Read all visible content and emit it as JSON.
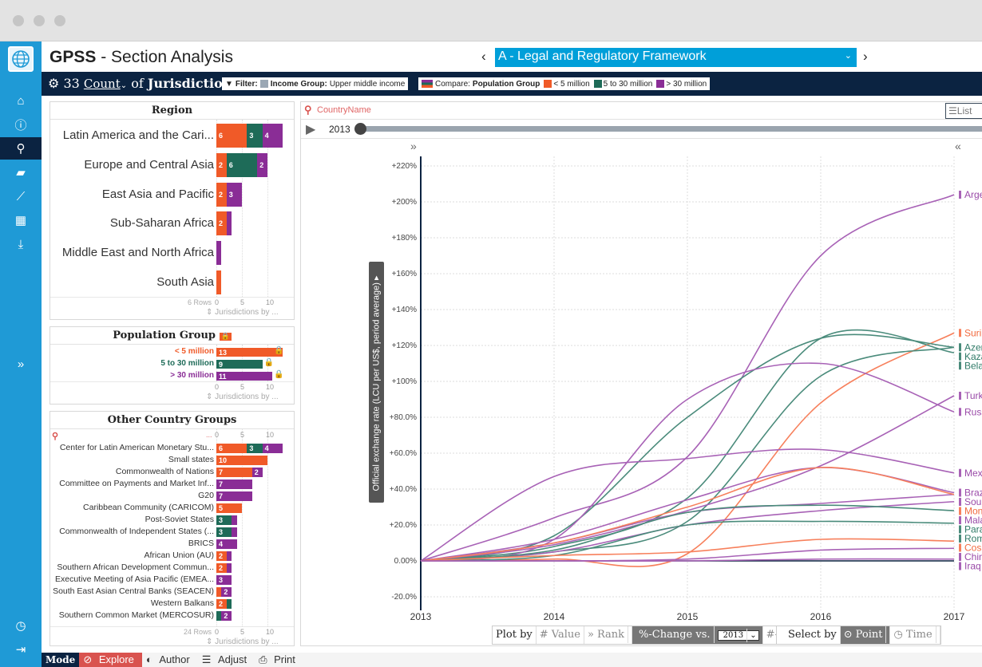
{
  "app": {
    "title_bold": "GPSS",
    "title_rest": " - Section Analysis",
    "section": "A - Legal and Regulatory Framework",
    "prev": "‹",
    "next": "›"
  },
  "sidebar": {
    "items": [
      {
        "icon": "home-icon",
        "glyph": "⌂"
      },
      {
        "icon": "info-icon",
        "glyph": "ⓘ"
      },
      {
        "icon": "search-icon",
        "glyph": "⚲",
        "active": true
      },
      {
        "icon": "folder-open-icon",
        "glyph": "▰"
      },
      {
        "icon": "line-chart-icon",
        "glyph": "⟋"
      },
      {
        "icon": "table-icon",
        "glyph": "▦"
      },
      {
        "icon": "download-icon",
        "glyph": "⤓"
      }
    ],
    "expand": "»",
    "clock": "◷",
    "signout": "⇥"
  },
  "navbar": {
    "count": "33",
    "measure": "Count",
    "of": "of",
    "entity": "Jurisdictions",
    "filter_label": "Filter:",
    "filter_field": "Income Group:",
    "filter_value": "Upper middle income",
    "compare_label": "Compare:",
    "compare_field": "Population Group",
    "legend": [
      {
        "label": "< 5 million",
        "color": "#f05a28"
      },
      {
        "label": "5 to 30 million",
        "color": "#1e6b58"
      },
      {
        "label": "> 30 million",
        "color": "#8a2d96"
      }
    ]
  },
  "colors": {
    "small": "#f05a28",
    "mid": "#1e6b58",
    "large": "#8a2d96",
    "small_line": "#f7805c",
    "mid_line": "#4a8b7b",
    "large_line": "#a862b6",
    "accent": "#009fd9",
    "navy": "#0b2341"
  },
  "region": {
    "title": "Region",
    "rows_label": "6 Rows",
    "axis": [
      "0",
      "5",
      "10"
    ],
    "footer": "Jurisdictions by ...",
    "rows": [
      {
        "label": "Latin America and the Cari...",
        "values": [
          6,
          3,
          4
        ]
      },
      {
        "label": "Europe and Central Asia",
        "values": [
          2,
          6,
          2
        ]
      },
      {
        "label": "East Asia and Pacific",
        "values": [
          2,
          0,
          3
        ]
      },
      {
        "label": "Sub-Saharan Africa",
        "values": [
          2,
          0,
          1
        ]
      },
      {
        "label": "Middle East and North Africa",
        "values": [
          0,
          0,
          1
        ]
      },
      {
        "label": "South Asia",
        "values": [
          1,
          0,
          0
        ]
      }
    ]
  },
  "population": {
    "title": "Population Group",
    "axis": [
      "0",
      "5",
      "10"
    ],
    "footer": "Jurisdictions by ...",
    "rows": [
      {
        "label": "< 5 million",
        "value": 13
      },
      {
        "label": "5 to 30 million",
        "value": 9
      },
      {
        "label": "> 30 million",
        "value": 11
      }
    ]
  },
  "other": {
    "title": "Other Country Groups",
    "search_hint": "...",
    "rows_label": "24 Rows",
    "axis": [
      "0",
      "5",
      "10"
    ],
    "footer": "Jurisdictions by ...",
    "rows": [
      {
        "label": "Center for Latin American Monetary Stu...",
        "values": [
          6,
          3,
          4
        ]
      },
      {
        "label": "Small states",
        "values": [
          10,
          0,
          0
        ]
      },
      {
        "label": "Commonwealth of Nations",
        "values": [
          7,
          0,
          2
        ]
      },
      {
        "label": "Committee on Payments and Market Inf...",
        "values": [
          0,
          0,
          7
        ]
      },
      {
        "label": "G20",
        "values": [
          0,
          0,
          7
        ]
      },
      {
        "label": "Caribbean Community (CARICOM)",
        "values": [
          5,
          0,
          0
        ]
      },
      {
        "label": "Post-Soviet States",
        "values": [
          0,
          3,
          1
        ]
      },
      {
        "label": "Commonwealth of Independent States (...",
        "values": [
          0,
          3,
          1
        ]
      },
      {
        "label": "BRICS",
        "values": [
          0,
          0,
          4
        ]
      },
      {
        "label": "African Union (AU)",
        "values": [
          2,
          0,
          1
        ]
      },
      {
        "label": "Southern African Development Commun...",
        "values": [
          2,
          0,
          1
        ]
      },
      {
        "label": "Executive Meeting of Asia Pacific (EMEA...",
        "values": [
          0,
          0,
          3
        ]
      },
      {
        "label": "South East Asian Central Banks (SEACEN)",
        "values": [
          1,
          0,
          2
        ]
      },
      {
        "label": "Western Balkans",
        "values": [
          2,
          1,
          0
        ]
      },
      {
        "label": "Southern Common Market (MERCOSUR)",
        "values": [
          0,
          1,
          2
        ]
      }
    ]
  },
  "chartpanel": {
    "search_placeholder": "CountryName",
    "list_label": "List",
    "year": "2013",
    "expand_left": "»",
    "expand_right": "«"
  },
  "chart_data": {
    "type": "line",
    "ylabel": "Official exchange rate (LCU per US$, period average)",
    "x": [
      2013,
      2014,
      2015,
      2016,
      2017
    ],
    "xticks": [
      "2013",
      "2014",
      "2015",
      "2016",
      "2017"
    ],
    "ylim": [
      -20,
      225
    ],
    "yticks": [
      {
        "v": 220,
        "t": "+220%"
      },
      {
        "v": 200,
        "t": "+200%"
      },
      {
        "v": 180,
        "t": "+180%"
      },
      {
        "v": 160,
        "t": "+160%"
      },
      {
        "v": 140,
        "t": "+140%"
      },
      {
        "v": 120,
        "t": "+120%"
      },
      {
        "v": 100,
        "t": "+100%"
      },
      {
        "v": 80,
        "t": "+80.0%"
      },
      {
        "v": 60,
        "t": "+60.0%"
      },
      {
        "v": 40,
        "t": "+40.0%"
      },
      {
        "v": 20,
        "t": "+20.0%"
      },
      {
        "v": 0,
        "t": "0.00%"
      },
      {
        "v": -20,
        "t": "-20.0%"
      }
    ],
    "grid": true,
    "series": [
      {
        "name": "Arge",
        "group": "large",
        "values": [
          0,
          24,
          58,
          170,
          204
        ]
      },
      {
        "name": "Suri",
        "group": "small",
        "values": [
          0,
          1,
          4,
          88,
          127
        ]
      },
      {
        "name": "Azer",
        "group": "mid",
        "values": [
          0,
          14,
          80,
          124,
          119
        ]
      },
      {
        "name": "Bela",
        "group": "mid",
        "values": [
          0,
          8,
          35,
          124,
          116
        ]
      },
      {
        "name": "Kaza",
        "group": "mid",
        "values": [
          0,
          5,
          22,
          103,
          119
        ]
      },
      {
        "name": "Turk",
        "group": "large",
        "values": [
          0,
          9,
          28,
          53,
          92
        ]
      },
      {
        "name": "Russ",
        "group": "large",
        "values": [
          0,
          12,
          90,
          110,
          83
        ]
      },
      {
        "name": "Mex",
        "group": "large",
        "values": [
          0,
          47,
          57,
          62,
          49
        ]
      },
      {
        "name": "Braz",
        "group": "large",
        "values": [
          0,
          12,
          34,
          52,
          38
        ]
      },
      {
        "name": "Sou",
        "group": "large",
        "values": [
          0,
          10,
          27,
          32,
          37
        ]
      },
      {
        "name": "Mala",
        "group": "large",
        "values": [
          0,
          5,
          20,
          28,
          33
        ]
      },
      {
        "name": "Para",
        "group": "mid",
        "values": [
          0,
          6,
          27,
          31,
          28
        ]
      },
      {
        "name": "Rom",
        "group": "mid",
        "values": [
          0,
          3,
          20,
          22,
          21
        ]
      },
      {
        "name": "Mon",
        "group": "small",
        "values": [
          0,
          10,
          30,
          52,
          37
        ]
      },
      {
        "name": "Cos",
        "group": "small",
        "values": [
          0,
          3,
          5,
          12,
          11
        ]
      },
      {
        "name": "Chin",
        "group": "large",
        "values": [
          0,
          0,
          1,
          6,
          7
        ]
      },
      {
        "name": "Iraq",
        "group": "large",
        "values": [
          0,
          0,
          0,
          1,
          1
        ]
      }
    ]
  },
  "controls": {
    "plot_by": "Plot by",
    "value": "# Value",
    "rank": "Rank",
    "pct": "%-Change vs.",
    "pct_year": "2013",
    "abs": "#-Change",
    "select_by": "Select by",
    "point": "Point",
    "time": "Time"
  },
  "mode": {
    "label": "Mode",
    "explore": "Explore",
    "author": "Author",
    "adjust": "Adjust",
    "print": "Print"
  }
}
